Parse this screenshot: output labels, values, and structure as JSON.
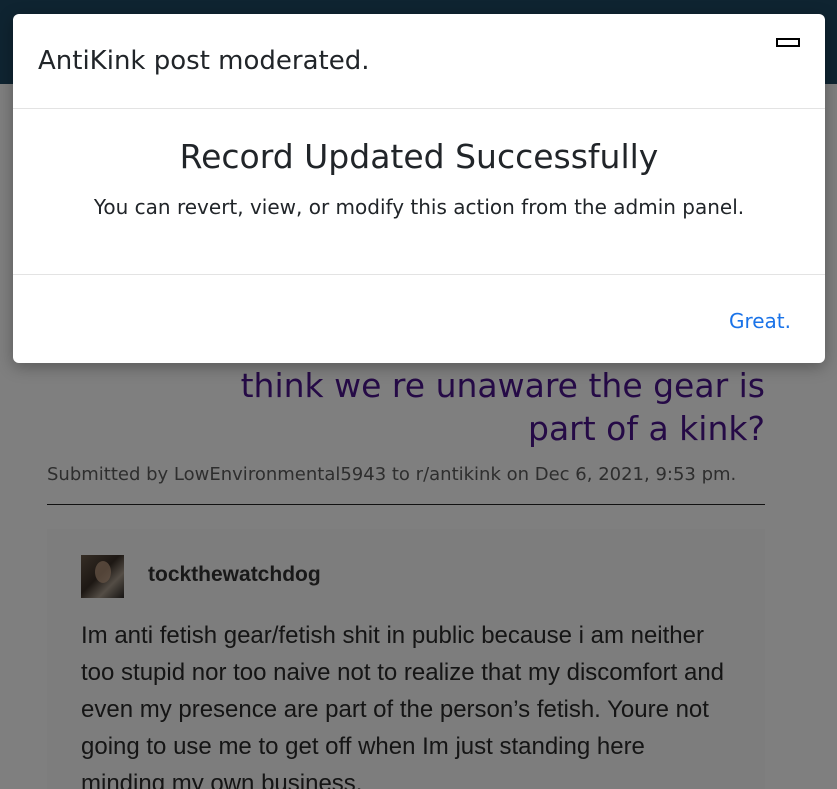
{
  "post": {
    "title": "think we re unaware the gear is part of a kink?",
    "submitted": "Submitted by LowEnvironmental5943 to r/antikink on Dec 6, 2021, 9:53 pm."
  },
  "embed": {
    "avatar_icon": "user-avatar",
    "username": "tockthewatchdog",
    "text": "Im anti fetish gear/fetish shit in public because i am neither too stupid nor too naive not to realize that my discomfort and even my presence are part of the person’s fetish. Youre not going to use me to get off when Im just standing here minding my own business."
  },
  "modal": {
    "title": "AntiKink post moderated.",
    "minimize_icon": "minimize-icon",
    "heading": "Record Updated Successfully",
    "message": "You can revert, view, or modify this action from the admin panel.",
    "confirm_label": "Great."
  },
  "colors": {
    "topbar": "#1f4863",
    "post_title": "#4a148c",
    "link": "#1a73e8",
    "backdrop": "rgba(0,0,0,0.5)"
  }
}
